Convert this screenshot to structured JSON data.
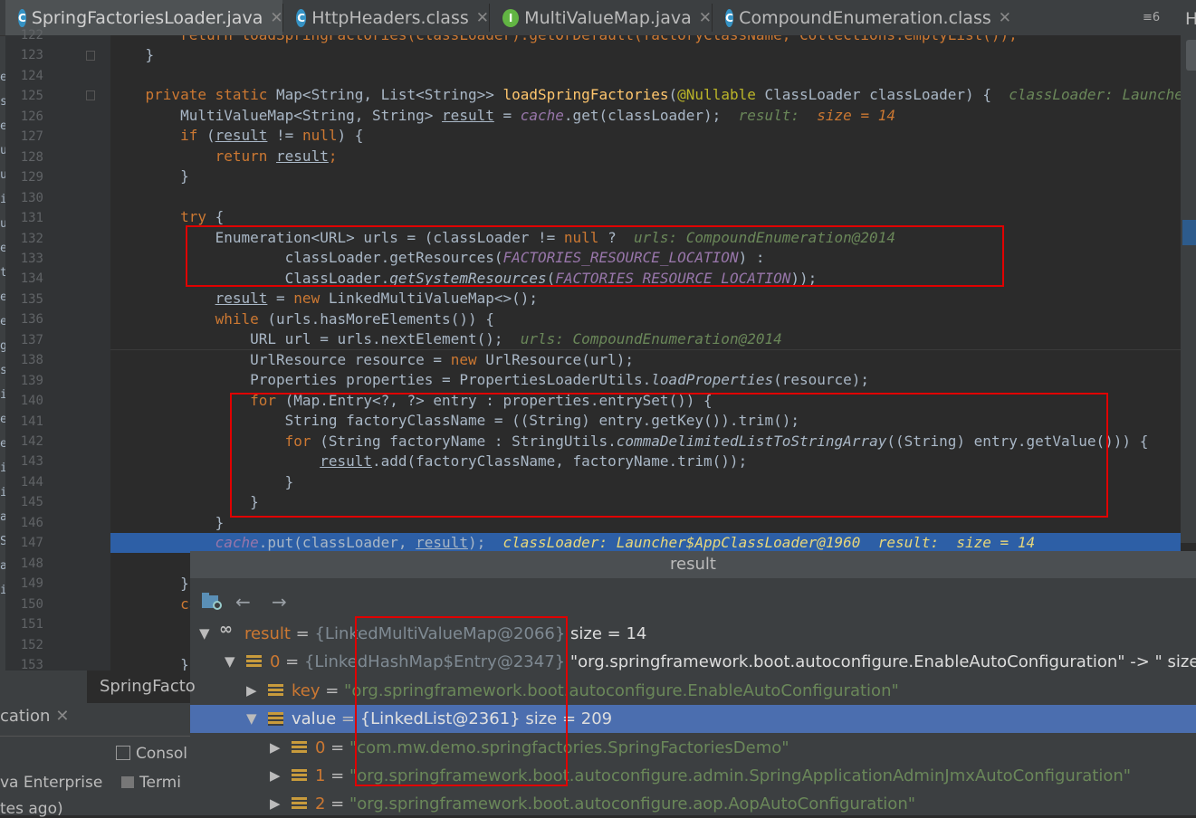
{
  "tabs": [
    {
      "label": "SpringFactoriesLoader.java",
      "icon": "C",
      "icon_color": "#3592c4",
      "active": true
    },
    {
      "label": "HttpHeaders.class",
      "icon": "C",
      "icon_color": "#3592c4",
      "active": false
    },
    {
      "label": "MultiValueMap.java",
      "icon": "I",
      "icon_color": "#62b543",
      "active": false
    },
    {
      "label": "CompoundEnumeration.class",
      "icon": "C",
      "icon_color": "#3592c4",
      "active": false
    }
  ],
  "tab_overflow": "≡6",
  "right_panel_char": "H",
  "line_numbers": [
    "122",
    "123",
    "124",
    "125",
    "126",
    "127",
    "128",
    "129",
    "130",
    "131",
    "132",
    "133",
    "134",
    "135",
    "136",
    "137",
    "138",
    "139",
    "140",
    "141",
    "142",
    "143",
    "144",
    "145",
    "146",
    "147",
    "148",
    "149",
    "150",
    "151",
    "152",
    "153"
  ],
  "left_edge_chars": [
    "e",
    "s",
    "e",
    "u",
    "u",
    "i",
    "u",
    "e",
    "t",
    "e",
    "e",
    "g",
    "s",
    "i",
    "e",
    "e",
    "i",
    "i",
    "a",
    "S",
    "a",
    "i"
  ],
  "code": {
    "l122": "        return loadSpringFactories(classLoader).getOrDefault(factoryClassName, Collections.emptyList());",
    "l123": "    }",
    "l125_kw": "    private static ",
    "l125_type": "Map<String, List<String>> ",
    "l125_method": "loadSpringFactories",
    "l125_open": "(",
    "l125_ann": "@Nullable",
    "l125_params": " ClassLoader classLoader) {",
    "l125_debug": "  classLoader: Launcher$AppClassLoader@1960",
    "l126_a": "        MultiValueMap<String, String> ",
    "l126_result": "result",
    "l126_b": " = ",
    "l126_cache": "cache",
    "l126_c": ".get(classLoader);",
    "l126_debug_a": "  result:  ",
    "l126_debug_b": "size = 14",
    "l127_kw": "        if ",
    "l127_a": "(",
    "l127_result": "result",
    "l127_b": " != ",
    "l127_null": "null",
    "l127_c": ") {",
    "l128_kw": "            return ",
    "l128_result": "result",
    "l128_c": ";",
    "l129": "        }",
    "l131_kw": "        try",
    "l131_b": " {",
    "l132_a": "            Enumeration<URL> urls = (classLoader != ",
    "l132_null": "null",
    "l132_b": " ?",
    "l132_debug": "  urls: CompoundEnumeration@2014",
    "l133_a": "                    classLoader.getResources(",
    "l133_const": "FACTORIES_RESOURCE_LOCATION",
    "l133_b": ") :",
    "l134_a": "                    ClassLoader.",
    "l134_method": "getSystemResources",
    "l134_b": "(",
    "l134_const": "FACTORIES_RESOURCE_LOCATION",
    "l134_c": "));",
    "l135_result": "result",
    "l135_a": " = ",
    "l135_new": "new",
    "l135_b": " LinkedMultiValueMap<>();",
    "l136_kw": "while",
    "l136_b": " (urls.hasMoreElements()) {",
    "l137_a": "                URL url = urls.nextElement();",
    "l137_debug": "  urls: CompoundEnumeration@2014",
    "l138_a": "                UrlResource resource = ",
    "l138_new": "new",
    "l138_b": " UrlResource(url);",
    "l139_a": "                Properties properties = PropertiesLoaderUtils.",
    "l139_method": "loadProperties",
    "l139_b": "(resource);",
    "l140_kw": "for",
    "l140_b": " (Map.Entry<?, ?> entry : properties.entrySet()) {",
    "l141_a": "                    String factoryClassName = ((String) entry.getKey()).trim();",
    "l142_kw": "for",
    "l142_b": " (String factoryName : StringUtils.",
    "l142_method": "commaDelimitedListToStringArray",
    "l142_c": "((String) entry.getValue())) {",
    "l143_result": "result",
    "l143_b": ".add(factoryClassName, factoryName.trim());",
    "l144": "                    }",
    "l145": "                }",
    "l146": "            }",
    "l147_cache": "cache",
    "l147_a": ".put(classLoader, ",
    "l147_result": "result",
    "l147_b": ");",
    "l147_debug": "  classLoader: Launcher$AppClassLoader@1960  result:  size = 14",
    "l149": "        }",
    "l150_kw": "cat",
    "l153": "        }"
  },
  "popup": {
    "title": "result",
    "back_icon": "←",
    "forward_icon": "→",
    "rows": [
      {
        "arrow": "▼",
        "icon": "oo",
        "name": "result",
        "eq": " = ",
        "type": "{LinkedMultiValueMap@2066}",
        "value": "  size = 14"
      },
      {
        "arrow": "▼",
        "icon": "field",
        "name": "0",
        "eq": " = ",
        "type": "{LinkedHashMap$Entry@2347}",
        "value": " \"org.springframework.boot.autoconfigure.EnableAutoConfiguration\" -> \" size = 209"
      },
      {
        "arrow": "▶",
        "icon": "field",
        "name": "key",
        "eq": " = ",
        "type": "",
        "value": "\"org.springframework.boot.autoconfigure.EnableAutoConfiguration\""
      },
      {
        "arrow": "▼",
        "icon": "field",
        "name": "value",
        "eq": " = ",
        "type": "{LinkedList@2361}",
        "value": "  size = 209",
        "selected": true
      },
      {
        "arrow": "▶",
        "icon": "field",
        "name": "0",
        "eq": " = ",
        "type": "",
        "value": "\"com.mw.demo.springfactories.SpringFactoriesDemo\""
      },
      {
        "arrow": "▶",
        "icon": "field",
        "name": "1",
        "eq": " = ",
        "type": "",
        "value": "\"org.springframework.boot.autoconfigure.admin.SpringApplicationAdminJmxAutoConfiguration\""
      },
      {
        "arrow": "▶",
        "icon": "field",
        "name": "2",
        "eq": " = ",
        "type": "",
        "value": "\"org.springframework.boot.autoconfigure.aop.AopAutoConfiguration\""
      }
    ]
  },
  "bottom_left": {
    "tab_label": "SpringFacto",
    "app_label": "cation",
    "console_label": "Consol",
    "java_label": "va Enterprise",
    "terminal_label": "Termi",
    "time_label": "tes ago)"
  },
  "colors": {
    "highlight": "#2d5fa6",
    "selected_row": "#4b6eaf",
    "annotation_box": "#e00000"
  }
}
